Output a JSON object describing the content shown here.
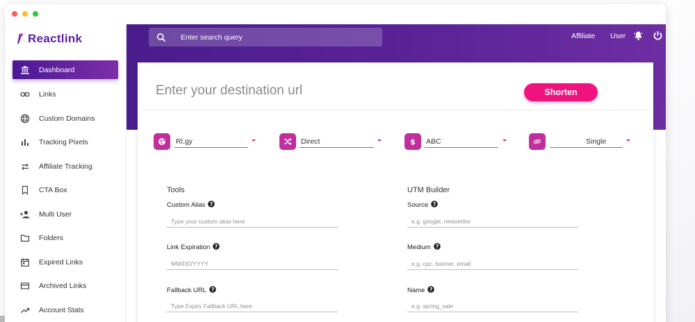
{
  "brand": {
    "name": "Reactlink"
  },
  "sidebar": {
    "items": [
      {
        "label": "Dashboard",
        "icon": "bank-icon",
        "active": true
      },
      {
        "label": "Links",
        "icon": "link-icon"
      },
      {
        "label": "Custom Domains",
        "icon": "globe-icon"
      },
      {
        "label": "Tracking Pixels",
        "icon": "bar-chart-icon"
      },
      {
        "label": "Affiliate Tracking",
        "icon": "swap-arrows-icon"
      },
      {
        "label": "CTA Box",
        "icon": "bookmark-icon"
      },
      {
        "label": "Multi User",
        "icon": "add-user-icon"
      },
      {
        "label": "Folders",
        "icon": "folder-icon"
      },
      {
        "label": "Expired Links",
        "icon": "calendar-icon"
      },
      {
        "label": "Archived Links",
        "icon": "card-icon"
      },
      {
        "label": "Account Stats",
        "icon": "trending-up-icon"
      }
    ]
  },
  "header": {
    "search_placeholder": "Enter search query",
    "affiliate_label": "Affiliate",
    "user_label": "User"
  },
  "main": {
    "destination_placeholder": "Enter your destination url",
    "shorten_label": "Shorten",
    "selectors": [
      {
        "value": "Rl.gy",
        "icon": "globe-icon"
      },
      {
        "value": "Direct",
        "icon": "shuffle-icon"
      },
      {
        "value": "ABC",
        "icon": "dollar-icon"
      },
      {
        "value": "Single",
        "icon": "link-icon"
      }
    ],
    "tools": {
      "title": "Tools",
      "fields": [
        {
          "label": "Custom Alias",
          "placeholder": "Type your custom alias here"
        },
        {
          "label": "Link Expiration",
          "placeholder": "MM/DD/YYYY"
        },
        {
          "label": "Fallback URL",
          "placeholder": "Type Expiry Fallback URL here"
        }
      ]
    },
    "utm": {
      "title": "UTM Builder",
      "fields": [
        {
          "label": "Source",
          "placeholder": "e.g. google, newsletter"
        },
        {
          "label": "Medium",
          "placeholder": "e.g. cpc, banner, email"
        },
        {
          "label": "Name",
          "placeholder": "e.g. spring_sale"
        }
      ]
    }
  },
  "colors": {
    "accent": "#f0137e",
    "primary": "#4a1c8c",
    "badge": "#c12e9e"
  }
}
